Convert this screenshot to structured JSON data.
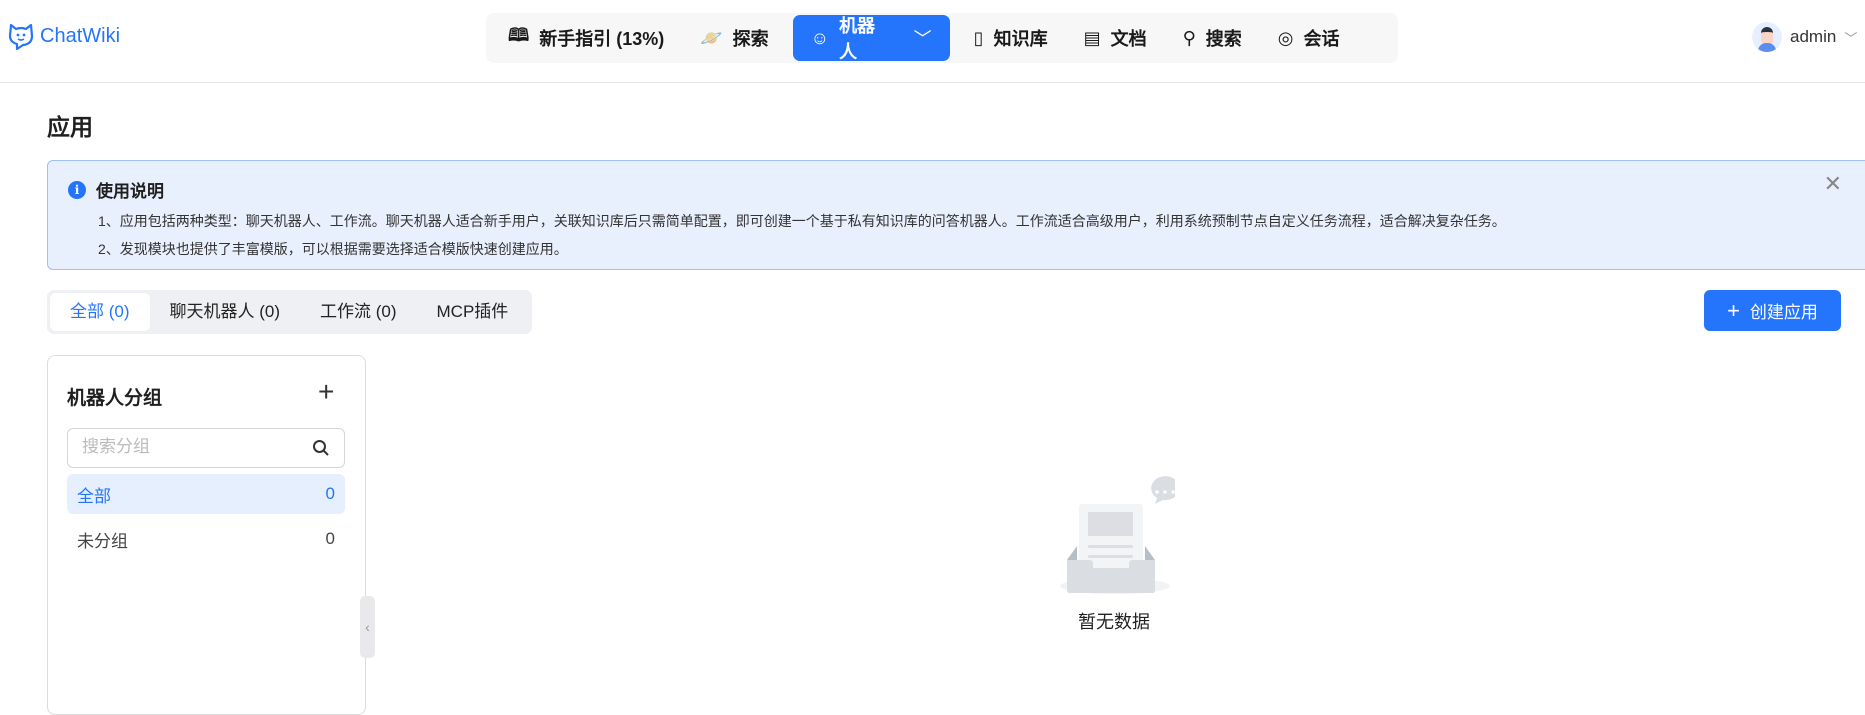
{
  "header": {
    "logo_text": "ChatWiki",
    "nav": [
      {
        "label": "新手指引 (13%)",
        "icon": "map-icon"
      },
      {
        "label": "探索",
        "icon": "planet-icon"
      },
      {
        "label": "机器人",
        "icon": "robot-icon",
        "active": true
      },
      {
        "label": "知识库",
        "icon": "book-icon"
      },
      {
        "label": "文档",
        "icon": "document-icon"
      },
      {
        "label": "搜索",
        "icon": "search-icon"
      },
      {
        "label": "会话",
        "icon": "chat-icon"
      }
    ],
    "user": "admin"
  },
  "page_title": "应用",
  "info": {
    "title": "使用说明",
    "lines": [
      "1、应用包括两种类型：聊天机器人、工作流。聊天机器人适合新手用户，关联知识库后只需简单配置，即可创建一个基于私有知识库的问答机器人。工作流适合高级用户，利用系统预制节点自定义任务流程，适合解决复杂任务。",
      "2、发现模块也提供了丰富模版，可以根据需要选择适合模版快速创建应用。"
    ]
  },
  "tabs": [
    "全部 (0)",
    "聊天机器人 (0)",
    "工作流 (0)",
    "MCP插件"
  ],
  "create_button": "创建应用",
  "groups_panel": {
    "title": "机器人分组",
    "search_placeholder": "搜索分组",
    "groups": [
      {
        "name": "全部",
        "count": "0"
      },
      {
        "name": "未分组",
        "count": "0"
      }
    ]
  },
  "empty_text": "暂无数据",
  "colors": {
    "accent": "#2475fc",
    "info_bg": "#e8effd"
  }
}
